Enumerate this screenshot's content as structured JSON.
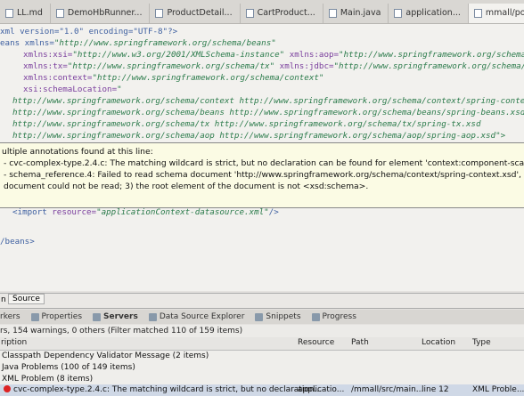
{
  "tabs": [
    {
      "label": "LL.md",
      "active": false
    },
    {
      "label": "DemoHbRunner...",
      "active": false
    },
    {
      "label": "ProductDetail...",
      "active": false
    },
    {
      "label": "CartProduct...",
      "active": false
    },
    {
      "label": "Main.java",
      "active": false
    },
    {
      "label": "application...",
      "active": false
    },
    {
      "label": "mmall/pom.xml",
      "active": true
    }
  ],
  "code": [
    {
      "a": "xml version=\"1.0\" encoding=\"UTF-8\"?>"
    },
    {
      "a": "eans xmlns=",
      "b": "\"http://www.springframework.org/schema/beans\""
    },
    {
      "a": "xmlns:xsi=",
      "b": "\"http://www.w3.org/2001/XMLSchema-instance\"",
      "c": " xmlns:aop=",
      "d": "\"http://www.springframework.org/schema/aop"
    },
    {
      "a": "xmlns:tx=",
      "b": "\"http://www.springframework.org/schema/tx\"",
      "c": " xmlns:jdbc=",
      "d": "\"http://www.springframework.org/schema/jdbc"
    },
    {
      "a": "xmlns:context=",
      "b": "\"http://www.springframework.org/schema/context\""
    },
    {
      "a": "xsi:schemaLocation=",
      "b": "\""
    },
    {
      "a": "",
      "b": "http://www.springframework.org/schema/context http://www.springframework.org/schema/context/spring-context.x"
    },
    {
      "a": "",
      "b": "http://www.springframework.org/schema/beans http://www.springframework.org/schema/beans/spring-beans.xsd"
    },
    {
      "a": "",
      "b": "http://www.springframework.org/schema/tx http://www.springframework.org/schema/tx/spring-tx.xsd"
    },
    {
      "a": "",
      "b": "http://www.springframework.org/schema/aop http://www.springframework.org/schema/aop/spring-aop.xsd\">"
    }
  ],
  "tooltip": {
    "title": "ultiple annotations found at this line:",
    "lines": [
      "- cvc-complex-type.2.4.c: The matching wildcard is strict, but no declaration can be found for element 'context:component-scan'.",
      "- schema_reference.4: Failed to read schema document 'http://www.springframework.org/schema/context/spring-context.xsd', because 1)",
      "document could not be read; 3) the root element of the document is not <xsd:schema>."
    ]
  },
  "import_line": {
    "tag": "<import ",
    "attr": "resource=",
    "val": "\"applicationContext-datasource.xml\"",
    "end": "/>"
  },
  "close_line": "/beans>",
  "editor_tabs": {
    "left": "n",
    "source": "Source"
  },
  "views": [
    {
      "label": "rkers",
      "icon": "markers-icon"
    },
    {
      "label": "Properties",
      "icon": "properties-icon"
    },
    {
      "label": "Servers",
      "icon": "servers-icon"
    },
    {
      "label": "Data Source Explorer",
      "icon": "datasource-icon"
    },
    {
      "label": "Snippets",
      "icon": "snippets-icon"
    },
    {
      "label": "Progress",
      "icon": "progress-icon"
    }
  ],
  "summary": "rs, 154 warnings, 0 others (Filter matched 110 of 159 items)",
  "columns": {
    "description": "ription",
    "resource": "Resource",
    "path": "Path",
    "location": "Location",
    "type": "Type"
  },
  "rows": [
    {
      "description": "Classpath Dependency Validator Message (2 items)"
    },
    {
      "description": "Java Problems (100 of 149 items)"
    },
    {
      "description": "XML Problem (8 items)"
    },
    {
      "description": "cvc-complex-type.2.4.c: The matching wildcard is strict, but no declaration...",
      "resource": "applicatio...",
      "path": "/mmall/src/main...",
      "location": "line 12",
      "type": "XML Proble..."
    }
  ]
}
